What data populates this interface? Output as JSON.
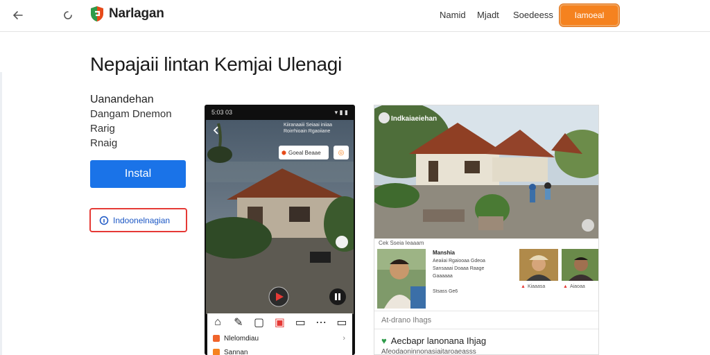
{
  "header": {
    "brand_name": "Narlagan",
    "nav": [
      "Namid",
      "Mjadt",
      "Soedeess"
    ],
    "cta_label": "Iamoeal"
  },
  "main": {
    "title": "Nepajaii lintan Kemjai Ulenagi",
    "meta": [
      "Uanandehan",
      "Dangam Dnemon",
      "Rarig",
      "Rnaig"
    ],
    "install_label": "Instal",
    "language_label": "Indoonelnagian"
  },
  "phone": {
    "status_time": "5:03 03",
    "overlay_lines": [
      "Kiiranaaiii Seiaai iniiaa",
      "Roirrhioain Rgaoiiane"
    ],
    "tag_label": "Goeal Beaae",
    "list_item": "Nlelomdiau",
    "list_item_2": "Sannan"
  },
  "card": {
    "photo_title": "Indkaiaeiehan",
    "caption": "Cek Sseia Ieaaam",
    "profile_name": "Manshia",
    "profile_lines": [
      "Aeaiiai Rgaiooaa Gdeoa",
      "Sansaaai Doaaa Raage",
      "Gaaaaaa"
    ],
    "profile_meta": "Stsass Ge6",
    "thumb_actions": [
      "Kiaaasa",
      "Aiaoaa"
    ],
    "sub_label": "At-drano Ihags",
    "row_title": "Aecbapr lanonana Ihjag",
    "row_sub": "Afeodaoninnonasiaitaroaeasss"
  },
  "colors": {
    "install": "#1a73e8",
    "cta": "#f5821f",
    "language_border": "#e53935"
  }
}
